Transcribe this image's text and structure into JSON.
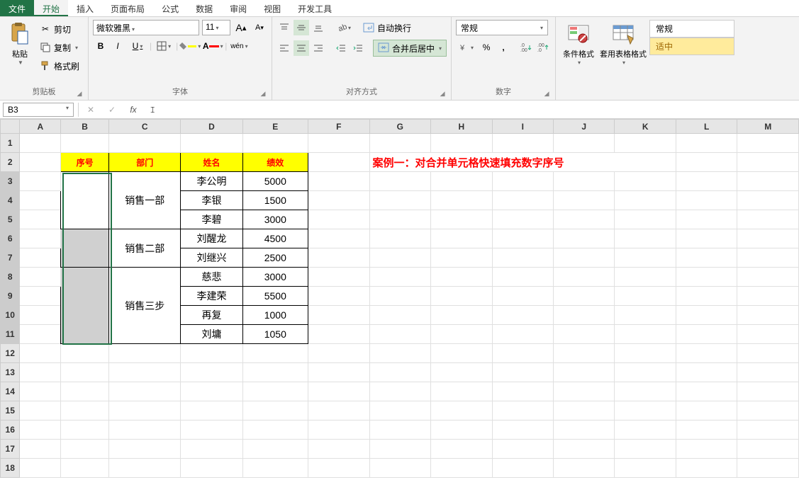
{
  "ribbon": {
    "tabs": [
      "文件",
      "开始",
      "插入",
      "页面布局",
      "公式",
      "数据",
      "审阅",
      "视图",
      "开发工具"
    ],
    "active_tab": "开始",
    "clipboard": {
      "paste": "粘贴",
      "cut": "剪切",
      "copy": "复制",
      "format_painter": "格式刷",
      "group_label": "剪贴板"
    },
    "font": {
      "name": "微软雅黑",
      "size": "11",
      "bold": "B",
      "italic": "I",
      "wen": "wén",
      "group_label": "字体"
    },
    "alignment": {
      "wrap": "自动换行",
      "merge": "合并后居中",
      "group_label": "对齐方式"
    },
    "number": {
      "format": "常规",
      "group_label": "数字"
    },
    "styles": {
      "cond_fmt": "条件格式",
      "table_fmt": "套用表格格式",
      "normal": "常规",
      "good": "适中"
    }
  },
  "formula_bar": {
    "name_box": "B3"
  },
  "columns": [
    "A",
    "B",
    "C",
    "D",
    "E",
    "F",
    "G",
    "H",
    "I",
    "J",
    "K",
    "L",
    "M"
  ],
  "rows_shown": 18,
  "table": {
    "headers": [
      "序号",
      "部门",
      "姓名",
      "绩效"
    ],
    "case_title": "案例一：对合并单元格快速填充数字序号",
    "dept1": "销售一部",
    "dept2": "销售二部",
    "dept3": "销售三步",
    "rows": [
      {
        "name": "李公明",
        "perf": "5000"
      },
      {
        "name": "李银",
        "perf": "1500"
      },
      {
        "name": "李碧",
        "perf": "3000"
      },
      {
        "name": "刘醒龙",
        "perf": "4500"
      },
      {
        "name": "刘继兴",
        "perf": "2500"
      },
      {
        "name": "慈悲",
        "perf": "3000"
      },
      {
        "name": "李建荣",
        "perf": "5500"
      },
      {
        "name": "再复",
        "perf": "1000"
      },
      {
        "name": "刘墉",
        "perf": "1050"
      }
    ]
  }
}
